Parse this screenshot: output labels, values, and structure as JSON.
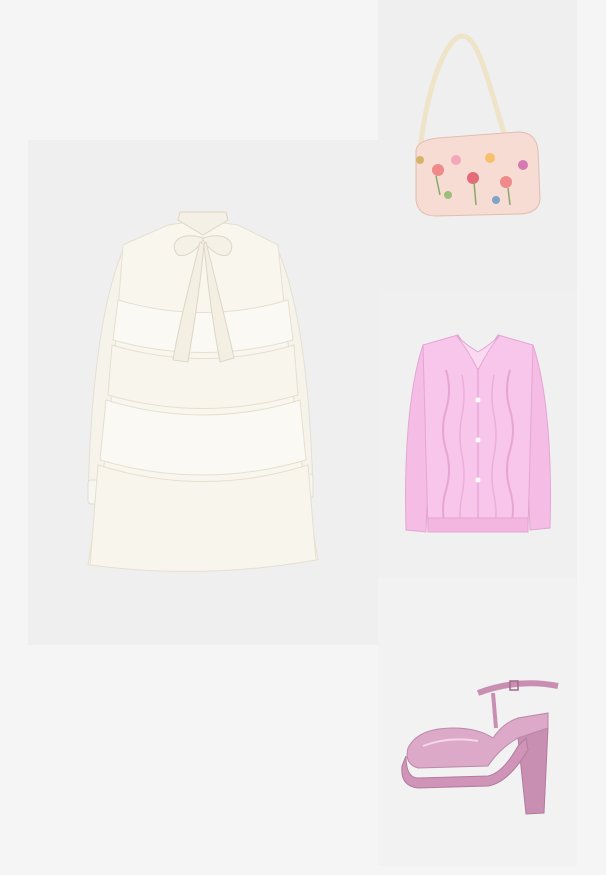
{
  "collage": {
    "background_color": "#f5f5f5",
    "items": [
      {
        "name": "dress",
        "tile_color": "#efefef",
        "main_color": "#f9f6ee"
      },
      {
        "name": "shoulder-bag",
        "tile_color": "#efefef",
        "main_color": "#f7d8cf"
      },
      {
        "name": "cardigan",
        "tile_color": "#f0f0f0",
        "main_color": "#f7c6ea"
      },
      {
        "name": "shoe",
        "tile_color": "#f2f2f2",
        "main_color": "#d9a7c4"
      }
    ]
  }
}
